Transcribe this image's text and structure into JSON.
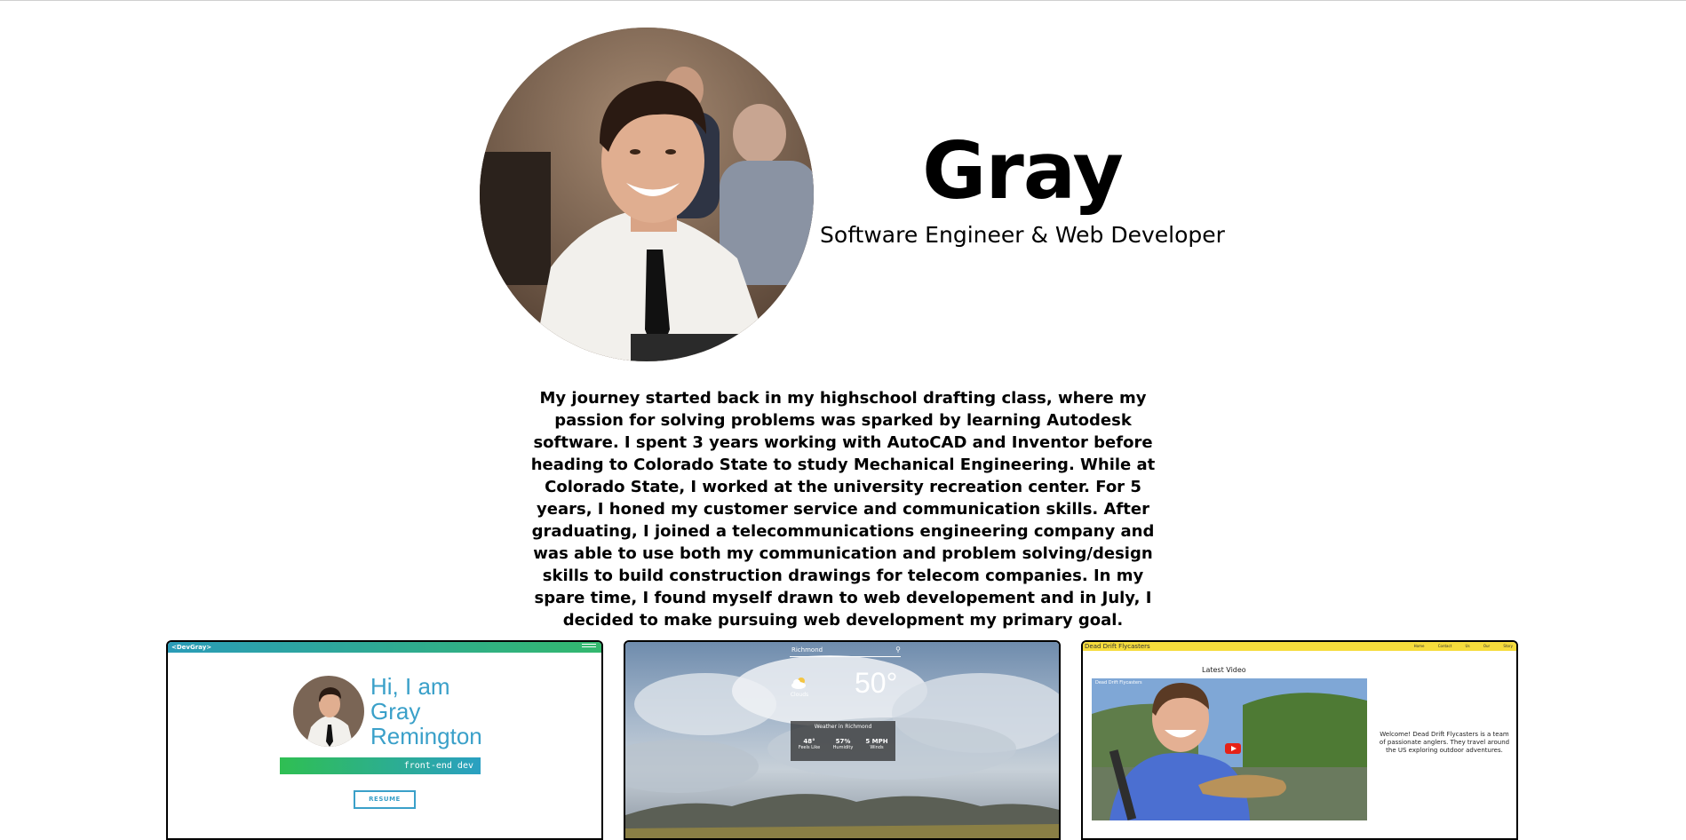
{
  "profile": {
    "name": "Gray",
    "tagline": "Software Engineer & Web Developer",
    "bio": "My journey started back in my highschool drafting class, where my passion for solving problems was sparked by learning Autodesk software. I spent 3 years working with AutoCAD and Inventor before heading to Colorado State to study Mechanical Engineering. While at Colorado State, I worked at the university recreation center. For 5 years, I honed my customer service and communication skills. After graduating, I joined a telecommunications engineering company and was able to use both my communication and problem solving/design skills to build construction drawings for telecom companies. In my spare time, I found myself drawn to web developement and in July, I decided to make pursuing web development my primary goal."
  },
  "projects": [
    {
      "brand": "<DevGray>",
      "greeting_lines": [
        "Hi, I am",
        "Gray",
        "Remington"
      ],
      "role": "front-end dev",
      "resume_label": "RESUME"
    },
    {
      "search_value": "Richmond",
      "condition": "Clouds",
      "temperature": "50°",
      "panel_title": "Weather in Richmond",
      "stats": [
        {
          "value": "48°",
          "label": "Feels Like"
        },
        {
          "value": "57%",
          "label": "Humidity"
        },
        {
          "value": "5 MPH",
          "label": "Winds"
        }
      ]
    },
    {
      "brand": "Dead Drift Flycasters",
      "nav": "Home Contact Us Our Story",
      "latest_label": "Latest Video",
      "channel": "Dead Drift Flycasters",
      "welcome_text": "Welcome! Dead Drift Flycasters is a team of passionate anglers. They travel around the US exploring outdoor adventures."
    }
  ],
  "colors": {
    "accent_blue": "#3aa0c9",
    "accent_green": "#33b86e",
    "fishing_yellow": "#f6dc3c"
  }
}
